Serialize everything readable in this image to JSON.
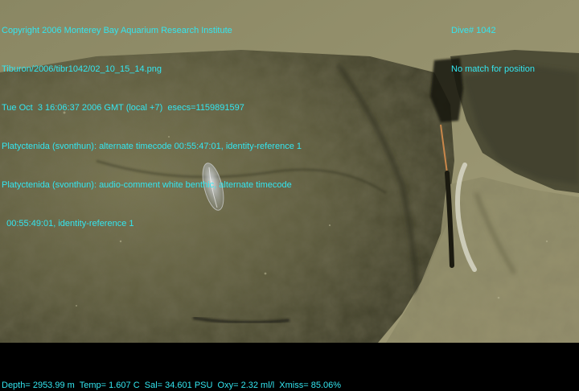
{
  "overlay": {
    "copyright": "Copyright 2006 Monterey Bay Aquarium Research Institute",
    "image_file": "Tiburon/2006/tibr1042/02_10_15_14.png",
    "datetime": "Tue Oct  3 16:06:37 2006 GMT (local +7)  esecs=1159891597",
    "annotation_1": "Platyctenida (svonthun): alternate timecode 00:55:47:01, identity-reference 1",
    "annotation_2_line1": "Platyctenida (svonthun): audio-comment white benthic, alternate timecode",
    "annotation_2_line2": "  00:55:49:01, identity-reference 1",
    "dive": "Dive# 1042",
    "position_status": "No match for position",
    "telemetry": "Depth= 2953.99 m  Temp= 1.607 C  Sal= 34.601 PSU  Oxy= 2.32 ml/l  Xmiss= 85.06%"
  },
  "colors": {
    "overlay_text": "#33e6f0",
    "letterbox": "#000000",
    "rock": "#6b6a48",
    "sediment": "#8f8a66"
  }
}
